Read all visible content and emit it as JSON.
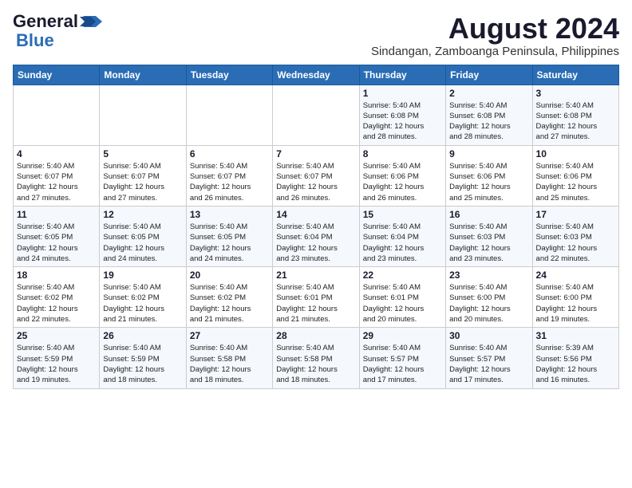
{
  "header": {
    "logo_line1": "General",
    "logo_line2": "Blue",
    "month_year": "August 2024",
    "location": "Sindangan, Zamboanga Peninsula, Philippines"
  },
  "calendar": {
    "days_of_week": [
      "Sunday",
      "Monday",
      "Tuesday",
      "Wednesday",
      "Thursday",
      "Friday",
      "Saturday"
    ],
    "weeks": [
      [
        {
          "day": "",
          "info": ""
        },
        {
          "day": "",
          "info": ""
        },
        {
          "day": "",
          "info": ""
        },
        {
          "day": "",
          "info": ""
        },
        {
          "day": "1",
          "info": "Sunrise: 5:40 AM\nSunset: 6:08 PM\nDaylight: 12 hours\nand 28 minutes."
        },
        {
          "day": "2",
          "info": "Sunrise: 5:40 AM\nSunset: 6:08 PM\nDaylight: 12 hours\nand 28 minutes."
        },
        {
          "day": "3",
          "info": "Sunrise: 5:40 AM\nSunset: 6:08 PM\nDaylight: 12 hours\nand 27 minutes."
        }
      ],
      [
        {
          "day": "4",
          "info": "Sunrise: 5:40 AM\nSunset: 6:07 PM\nDaylight: 12 hours\nand 27 minutes."
        },
        {
          "day": "5",
          "info": "Sunrise: 5:40 AM\nSunset: 6:07 PM\nDaylight: 12 hours\nand 27 minutes."
        },
        {
          "day": "6",
          "info": "Sunrise: 5:40 AM\nSunset: 6:07 PM\nDaylight: 12 hours\nand 26 minutes."
        },
        {
          "day": "7",
          "info": "Sunrise: 5:40 AM\nSunset: 6:07 PM\nDaylight: 12 hours\nand 26 minutes."
        },
        {
          "day": "8",
          "info": "Sunrise: 5:40 AM\nSunset: 6:06 PM\nDaylight: 12 hours\nand 26 minutes."
        },
        {
          "day": "9",
          "info": "Sunrise: 5:40 AM\nSunset: 6:06 PM\nDaylight: 12 hours\nand 25 minutes."
        },
        {
          "day": "10",
          "info": "Sunrise: 5:40 AM\nSunset: 6:06 PM\nDaylight: 12 hours\nand 25 minutes."
        }
      ],
      [
        {
          "day": "11",
          "info": "Sunrise: 5:40 AM\nSunset: 6:05 PM\nDaylight: 12 hours\nand 24 minutes."
        },
        {
          "day": "12",
          "info": "Sunrise: 5:40 AM\nSunset: 6:05 PM\nDaylight: 12 hours\nand 24 minutes."
        },
        {
          "day": "13",
          "info": "Sunrise: 5:40 AM\nSunset: 6:05 PM\nDaylight: 12 hours\nand 24 minutes."
        },
        {
          "day": "14",
          "info": "Sunrise: 5:40 AM\nSunset: 6:04 PM\nDaylight: 12 hours\nand 23 minutes."
        },
        {
          "day": "15",
          "info": "Sunrise: 5:40 AM\nSunset: 6:04 PM\nDaylight: 12 hours\nand 23 minutes."
        },
        {
          "day": "16",
          "info": "Sunrise: 5:40 AM\nSunset: 6:03 PM\nDaylight: 12 hours\nand 23 minutes."
        },
        {
          "day": "17",
          "info": "Sunrise: 5:40 AM\nSunset: 6:03 PM\nDaylight: 12 hours\nand 22 minutes."
        }
      ],
      [
        {
          "day": "18",
          "info": "Sunrise: 5:40 AM\nSunset: 6:02 PM\nDaylight: 12 hours\nand 22 minutes."
        },
        {
          "day": "19",
          "info": "Sunrise: 5:40 AM\nSunset: 6:02 PM\nDaylight: 12 hours\nand 21 minutes."
        },
        {
          "day": "20",
          "info": "Sunrise: 5:40 AM\nSunset: 6:02 PM\nDaylight: 12 hours\nand 21 minutes."
        },
        {
          "day": "21",
          "info": "Sunrise: 5:40 AM\nSunset: 6:01 PM\nDaylight: 12 hours\nand 21 minutes."
        },
        {
          "day": "22",
          "info": "Sunrise: 5:40 AM\nSunset: 6:01 PM\nDaylight: 12 hours\nand 20 minutes."
        },
        {
          "day": "23",
          "info": "Sunrise: 5:40 AM\nSunset: 6:00 PM\nDaylight: 12 hours\nand 20 minutes."
        },
        {
          "day": "24",
          "info": "Sunrise: 5:40 AM\nSunset: 6:00 PM\nDaylight: 12 hours\nand 19 minutes."
        }
      ],
      [
        {
          "day": "25",
          "info": "Sunrise: 5:40 AM\nSunset: 5:59 PM\nDaylight: 12 hours\nand 19 minutes."
        },
        {
          "day": "26",
          "info": "Sunrise: 5:40 AM\nSunset: 5:59 PM\nDaylight: 12 hours\nand 18 minutes."
        },
        {
          "day": "27",
          "info": "Sunrise: 5:40 AM\nSunset: 5:58 PM\nDaylight: 12 hours\nand 18 minutes."
        },
        {
          "day": "28",
          "info": "Sunrise: 5:40 AM\nSunset: 5:58 PM\nDaylight: 12 hours\nand 18 minutes."
        },
        {
          "day": "29",
          "info": "Sunrise: 5:40 AM\nSunset: 5:57 PM\nDaylight: 12 hours\nand 17 minutes."
        },
        {
          "day": "30",
          "info": "Sunrise: 5:40 AM\nSunset: 5:57 PM\nDaylight: 12 hours\nand 17 minutes."
        },
        {
          "day": "31",
          "info": "Sunrise: 5:39 AM\nSunset: 5:56 PM\nDaylight: 12 hours\nand 16 minutes."
        }
      ]
    ]
  }
}
